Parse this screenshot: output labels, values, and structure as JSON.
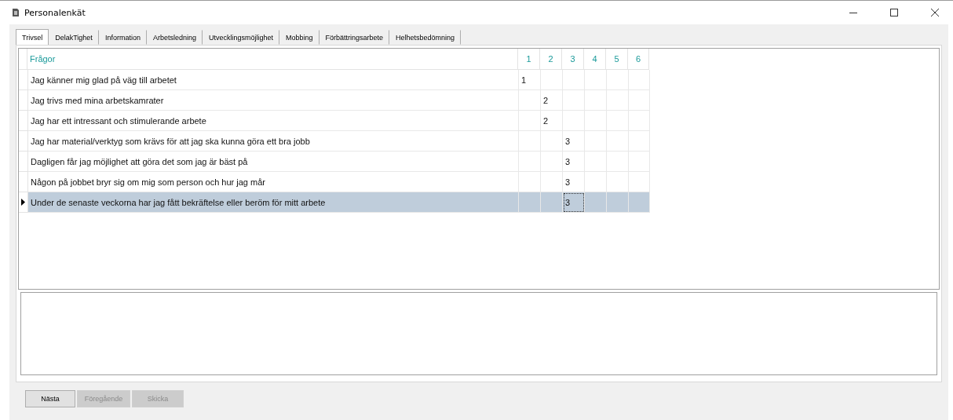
{
  "window": {
    "title": "Personalenkät"
  },
  "tabs": [
    {
      "label": "Trivsel",
      "selected": true
    },
    {
      "label": "DelakTighet",
      "selected": false
    },
    {
      "label": "Information",
      "selected": false
    },
    {
      "label": "Arbetsledning",
      "selected": false
    },
    {
      "label": "Utvecklingsmöjlighet",
      "selected": false
    },
    {
      "label": "Mobbing",
      "selected": false
    },
    {
      "label": "Förbättringsarbete",
      "selected": false
    },
    {
      "label": "Helhetsbedömning",
      "selected": false
    }
  ],
  "table": {
    "columns": [
      "Frågor",
      "1",
      "2",
      "3",
      "4",
      "5",
      "6"
    ],
    "rows": [
      {
        "question": "Jag känner mig glad på väg till arbetet",
        "answers": [
          {
            "kind": "answer",
            "value": "1"
          },
          {
            "kind": "empty"
          },
          {
            "kind": "empty"
          },
          {
            "kind": "empty"
          },
          {
            "kind": "empty"
          },
          {
            "kind": "empty"
          }
        ],
        "selected": false
      },
      {
        "question": "Jag trivs med mina arbetskamrater",
        "answers": [
          {
            "kind": "empty"
          },
          {
            "kind": "answer",
            "value": "2"
          },
          {
            "kind": "empty"
          },
          {
            "kind": "empty"
          },
          {
            "kind": "empty"
          },
          {
            "kind": "empty"
          }
        ],
        "selected": false
      },
      {
        "question": "Jag har ett intressant och stimulerande arbete",
        "answers": [
          {
            "kind": "empty"
          },
          {
            "kind": "answer",
            "value": "2"
          },
          {
            "kind": "empty"
          },
          {
            "kind": "empty"
          },
          {
            "kind": "empty"
          },
          {
            "kind": "empty"
          }
        ],
        "selected": false
      },
      {
        "question": "Jag har material/verktyg som krävs för att jag ska kunna göra ett bra jobb",
        "answers": [
          {
            "kind": "empty"
          },
          {
            "kind": "empty"
          },
          {
            "kind": "answer",
            "value": "3"
          },
          {
            "kind": "empty"
          },
          {
            "kind": "empty"
          },
          {
            "kind": "empty"
          }
        ],
        "selected": false
      },
      {
        "question": "Dagligen får jag möjlighet att göra det som jag är bäst på",
        "answers": [
          {
            "kind": "empty"
          },
          {
            "kind": "empty"
          },
          {
            "kind": "answer",
            "value": "3"
          },
          {
            "kind": "empty"
          },
          {
            "kind": "empty"
          },
          {
            "kind": "empty"
          }
        ],
        "selected": false
      },
      {
        "question": "Någon på jobbet bryr sig om mig som person och hur jag mår",
        "answers": [
          {
            "kind": "empty"
          },
          {
            "kind": "empty"
          },
          {
            "kind": "answer",
            "value": "3"
          },
          {
            "kind": "empty"
          },
          {
            "kind": "empty"
          },
          {
            "kind": "empty"
          }
        ],
        "selected": false
      },
      {
        "question": "Under de senaste veckorna har jag fått bekräftelse eller beröm för mitt arbete",
        "answers": [
          {
            "kind": "empty"
          },
          {
            "kind": "empty"
          },
          {
            "kind": "answer",
            "value": "3"
          },
          {
            "kind": "empty"
          },
          {
            "kind": "empty"
          },
          {
            "kind": "empty"
          }
        ],
        "selected": true
      }
    ]
  },
  "buttons": [
    {
      "label": "Nästa",
      "disabled": false
    },
    {
      "label": "Föregående",
      "disabled": true
    },
    {
      "label": "Skicka",
      "disabled": true
    }
  ]
}
